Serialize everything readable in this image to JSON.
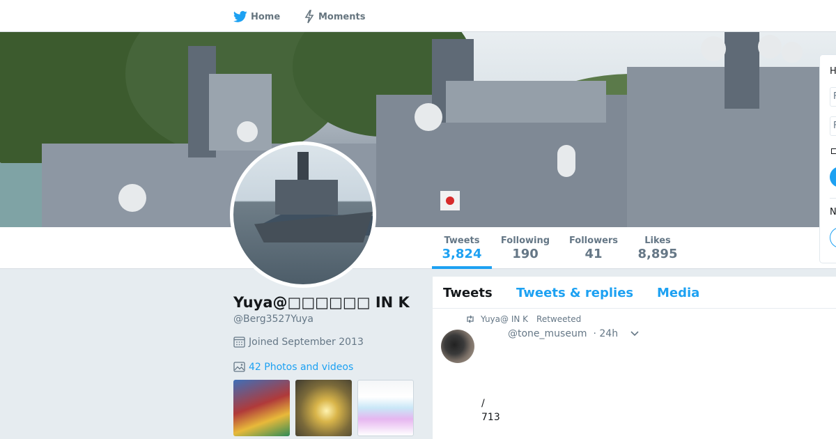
{
  "nav": {
    "home_label": "Home",
    "moments_label": "Moments"
  },
  "stats": [
    {
      "label": "Tweets",
      "value": "3,824",
      "active": true
    },
    {
      "label": "Following",
      "value": "190"
    },
    {
      "label": "Followers",
      "value": "41"
    },
    {
      "label": "Likes",
      "value": "8,895"
    }
  ],
  "profile": {
    "name": "Yuya@□□□□□□ IN K",
    "handle": "@Berg3527Yuya",
    "joined": "Joined September 2013",
    "photos_link": "42 Photos and videos"
  },
  "timeline": {
    "tabs": [
      "Tweets",
      "Tweets & replies",
      "Media"
    ],
    "retweeter": "Yuya@ IN K",
    "retweeted_label": "Retweeted",
    "tweet_handle": "@tone_museum",
    "tweet_time": "· 24h",
    "tweet_text_line1": "/",
    "tweet_text_line2": "713"
  },
  "side_widget": {
    "heading_initial": "H",
    "field1_initial": "F",
    "field2_initial": "F",
    "section_initial": "N"
  },
  "colors": {
    "accent": "#1da1f2",
    "text": "#14171a",
    "muted": "#657786",
    "background": "#e6ecf0"
  }
}
